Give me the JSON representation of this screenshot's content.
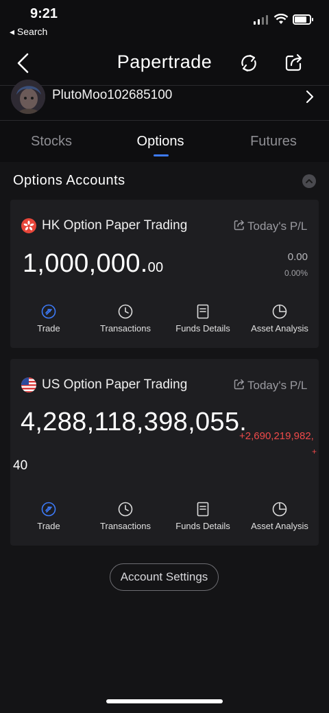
{
  "status_bar": {
    "time": "9:21",
    "back_app": "◂ Search"
  },
  "nav": {
    "title": "Papertrade"
  },
  "profile": {
    "username": "PlutoMoo102685100"
  },
  "tabs": [
    {
      "label": "Stocks",
      "active": false
    },
    {
      "label": "Options",
      "active": true
    },
    {
      "label": "Futures",
      "active": false
    }
  ],
  "section": {
    "title": "Options Accounts"
  },
  "accounts": [
    {
      "name": "HK Option Paper Trading",
      "flag": "hk",
      "today_label": "Today's P/L",
      "balance_main": "1,000,000.",
      "balance_cents": "00",
      "pl_value": "0.00",
      "pl_percent": "0.00%"
    },
    {
      "name": "US Option Paper Trading",
      "flag": "us",
      "today_label": "Today's P/L",
      "balance_main": "4,288,118,398,055.",
      "balance_cents": "40",
      "pl_value": "+2,690,219,982,",
      "pl_percent": "+"
    }
  ],
  "actions": [
    {
      "label": "Trade",
      "icon": "trade-icon",
      "accent": true
    },
    {
      "label": "Transactions",
      "icon": "clock-icon",
      "accent": false
    },
    {
      "label": "Funds Details",
      "icon": "document-icon",
      "accent": false
    },
    {
      "label": "Asset Analysis",
      "icon": "pie-chart-icon",
      "accent": false
    }
  ],
  "settings_button": "Account Settings",
  "colors": {
    "accent": "#3d7bfa",
    "negative_red": "#f04a4a",
    "background": "#0e0e10",
    "card": "#1e1e21"
  }
}
